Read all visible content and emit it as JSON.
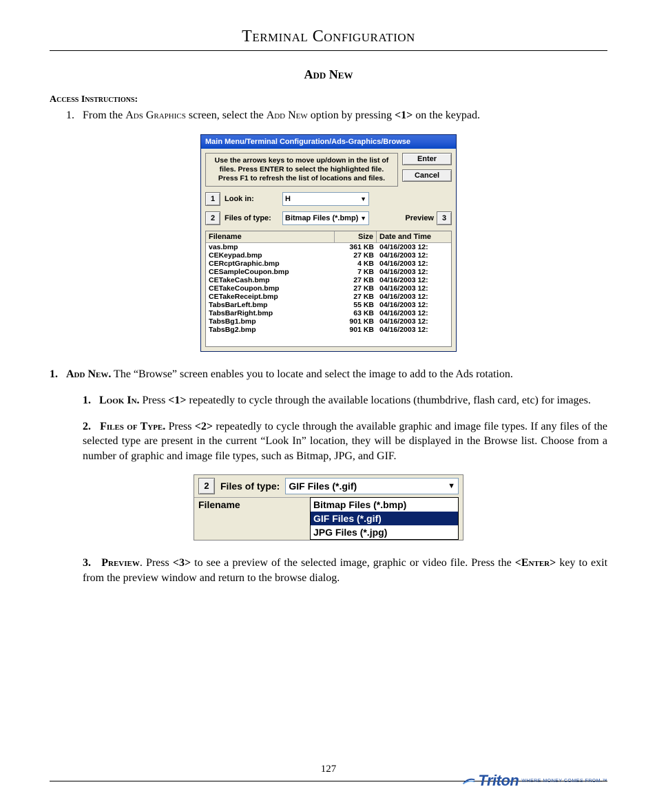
{
  "header": {
    "title": "Terminal Configuration"
  },
  "section": {
    "title": "Add New"
  },
  "access": {
    "label": "Access Instructions:"
  },
  "toplist": {
    "item1_pre": "From the ",
    "item1_sc1": "Ads Graphics",
    "item1_mid": " screen, select the ",
    "item1_sc2": "Add New",
    "item1_mid2": " option by pressing ",
    "item1_key": "<1>",
    "item1_end": " on the keypad."
  },
  "dialog1": {
    "titlebar": "Main Menu/Terminal Configuration/Ads-Graphics/Browse",
    "help": "Use the arrows keys to move up/down in the list of files.  Press ENTER to select the highlighted file.  Press F1 to refresh the list of locations and files.",
    "enter": "Enter",
    "cancel": "Cancel",
    "btn1": "1",
    "lookin_label": "Look in:",
    "lookin_value": "H",
    "btn2": "2",
    "ftype_label": "Files of type:",
    "ftype_value": "Bitmap Files (*.bmp)",
    "preview_label": "Preview",
    "btn3": "3",
    "col_name": "Filename",
    "col_size": "Size",
    "col_date": "Date and Time",
    "rows": [
      {
        "n": "vas.bmp",
        "s": "361 KB",
        "d": "04/16/2003 12:"
      },
      {
        "n": "CEKeypad.bmp",
        "s": "27 KB",
        "d": "04/16/2003 12:"
      },
      {
        "n": "CERcptGraphic.bmp",
        "s": "4 KB",
        "d": "04/16/2003 12:"
      },
      {
        "n": "CESampleCoupon.bmp",
        "s": "7 KB",
        "d": "04/16/2003 12:"
      },
      {
        "n": "CETakeCash.bmp",
        "s": "27 KB",
        "d": "04/16/2003 12:"
      },
      {
        "n": "CETakeCoupon.bmp",
        "s": "27 KB",
        "d": "04/16/2003 12:"
      },
      {
        "n": "CETakeReceipt.bmp",
        "s": "27 KB",
        "d": "04/16/2003 12:"
      },
      {
        "n": "TabsBarLeft.bmp",
        "s": "55 KB",
        "d": "04/16/2003 12:"
      },
      {
        "n": "TabsBarRight.bmp",
        "s": "63 KB",
        "d": "04/16/2003 12:"
      },
      {
        "n": "TabsBg1.bmp",
        "s": "901 KB",
        "d": "04/16/2003 12:"
      },
      {
        "n": "TabsBg2.bmp",
        "s": "901 KB",
        "d": "04/16/2003 12:"
      }
    ]
  },
  "body": {
    "p1_num": "1.",
    "p1_head": "Add New.",
    "p1_text": "  The “Browse” screen enables you to locate and select the image to add to the Ads rotation.",
    "p1a_num": "1.",
    "p1a_head": "Look In.",
    "p1a_text1": "  Press ",
    "p1a_key": "<1>",
    "p1a_text2": " repeatedly to cycle through the available locations (thumbdrive, flash card, etc) for images.",
    "p1b_num": "2.",
    "p1b_head": "Files of Type.",
    "p1b_text1": "  Press ",
    "p1b_key": "<2>",
    "p1b_text2": " repeatedly to cycle through the available graphic and image file types. If any files of the selected type are present in the current “Look In” location, they will be displayed in the Browse list.  Choose from a number of graphic and image file types, such as Bitmap, JPG, and GIF.",
    "p1c_num": "3.",
    "p1c_head": "Preview",
    "p1c_text1": ".  Press ",
    "p1c_key": "<3>",
    "p1c_text2": " to see a preview of the selected image, graphic or video file. Press the ",
    "p1c_key2": "<Enter>",
    "p1c_text3": " key to exit from the preview window and return to the browse dialog."
  },
  "dialog2": {
    "btn2": "2",
    "label": "Files of type:",
    "value": "GIF Files (*.gif)",
    "opt1": "Bitmap Files (*.bmp)",
    "opt2": "GIF Files (*.gif)",
    "opt3": "JPG Files (*.jpg)",
    "fname": "Filename"
  },
  "footer": {
    "pagenum": "127",
    "brand": "Triton",
    "tagline": "WHERE MONEY COMES FROM.™"
  }
}
